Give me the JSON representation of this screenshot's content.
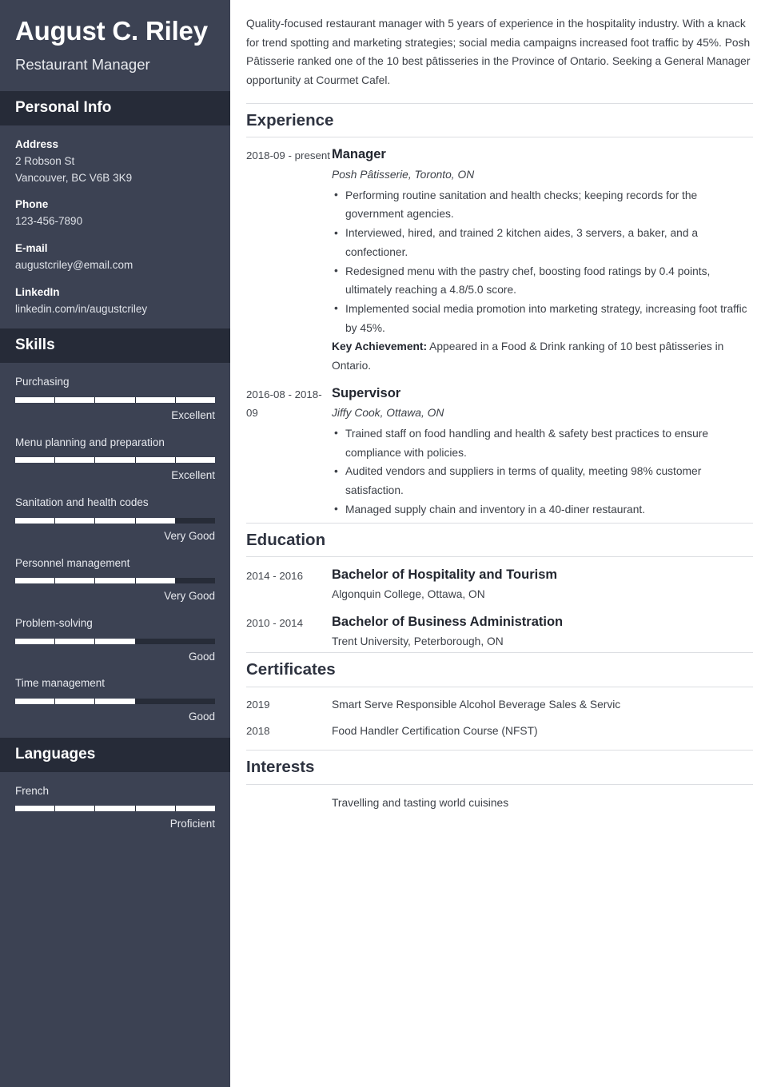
{
  "sidebar": {
    "name": "August C. Riley",
    "job_title": "Restaurant Manager",
    "personal_info": {
      "heading": "Personal Info",
      "fields": [
        {
          "label": "Address",
          "value_line1": "2 Robson St",
          "value_line2": "Vancouver, BC V6B 3K9"
        },
        {
          "label": "Phone",
          "value_line1": "123-456-7890"
        },
        {
          "label": "E-mail",
          "value_line1": "augustcriley@email.com"
        },
        {
          "label": "LinkedIn",
          "value_line1": "linkedin.com/in/augustcriley"
        }
      ]
    },
    "skills": {
      "heading": "Skills",
      "items": [
        {
          "name": "Purchasing",
          "level": "Excellent",
          "filled": 5,
          "total": 5
        },
        {
          "name": "Menu planning and preparation",
          "level": "Excellent",
          "filled": 5,
          "total": 5
        },
        {
          "name": "Sanitation and health codes",
          "level": "Very Good",
          "filled": 4,
          "total": 5
        },
        {
          "name": "Personnel management",
          "level": "Very Good",
          "filled": 4,
          "total": 5
        },
        {
          "name": "Problem-solving",
          "level": "Good",
          "filled": 3,
          "total": 5
        },
        {
          "name": "Time management",
          "level": "Good",
          "filled": 3,
          "total": 5
        }
      ]
    },
    "languages": {
      "heading": "Languages",
      "items": [
        {
          "name": "French",
          "level": "Proficient",
          "filled": 5,
          "total": 5
        }
      ]
    }
  },
  "main": {
    "summary": "Quality-focused restaurant manager with 5 years of experience in the hospitality industry. With a knack for trend spotting and marketing strategies; social media campaigns increased foot traffic by 45%. Posh Pâtisserie ranked one of the 10 best pâtisseries in the Province of Ontario. Seeking a General Manager opportunity at Courmet Cafel.",
    "experience": {
      "heading": "Experience",
      "entries": [
        {
          "date": "2018-09 - present",
          "title": "Manager",
          "org": "Posh Pâtisserie, Toronto, ON",
          "bullets": [
            "Performing routine sanitation and health checks; keeping records for the government agencies.",
            "Interviewed, hired, and trained 2 kitchen aides, 3 servers, a baker, and a confectioner.",
            "Redesigned menu with the pastry chef, boosting food ratings by 0.4 points, ultimately reaching a 4.8/5.0 score.",
            "Implemented social media promotion into marketing strategy, increasing foot traffic by 45%."
          ],
          "achievement_label": "Key Achievement:",
          "achievement_text": " Appeared in a Food & Drink ranking of 10 best pâtisseries in Ontario."
        },
        {
          "date": "2016-08 - 2018-09",
          "title": "Supervisor",
          "org": "Jiffy Cook, Ottawa, ON",
          "bullets": [
            "Trained staff on food handling and health & safety best practices to ensure compliance with policies.",
            "Audited vendors and suppliers in terms of quality, meeting 98% customer satisfaction.",
            "Managed supply chain and inventory in a 40-diner restaurant."
          ]
        }
      ]
    },
    "education": {
      "heading": "Education",
      "entries": [
        {
          "date": "2014 - 2016",
          "title": "Bachelor of Hospitality and Tourism",
          "org": "Algonquin College, Ottawa, ON"
        },
        {
          "date": "2010 - 2014",
          "title": "Bachelor of Business Administration",
          "org": "Trent University, Peterborough, ON"
        }
      ]
    },
    "certificates": {
      "heading": "Certificates",
      "entries": [
        {
          "date": "2019",
          "text": "Smart Serve Responsible Alcohol Beverage Sales & Servic"
        },
        {
          "date": "2018",
          "text": "Food Handler Certification Course (NFST)"
        }
      ]
    },
    "interests": {
      "heading": "Interests",
      "entries": [
        {
          "date": "",
          "text": "Travelling and tasting world cuisines"
        }
      ]
    }
  },
  "colors": {
    "sidebar_bg": "#3c4253",
    "sidebar_band": "#262b38",
    "bar_fill": "#ffffff",
    "bar_track": "#272c38",
    "rule": "#dcdee2",
    "heading_text": "#2e3340",
    "body_text": "#3d4148"
  }
}
